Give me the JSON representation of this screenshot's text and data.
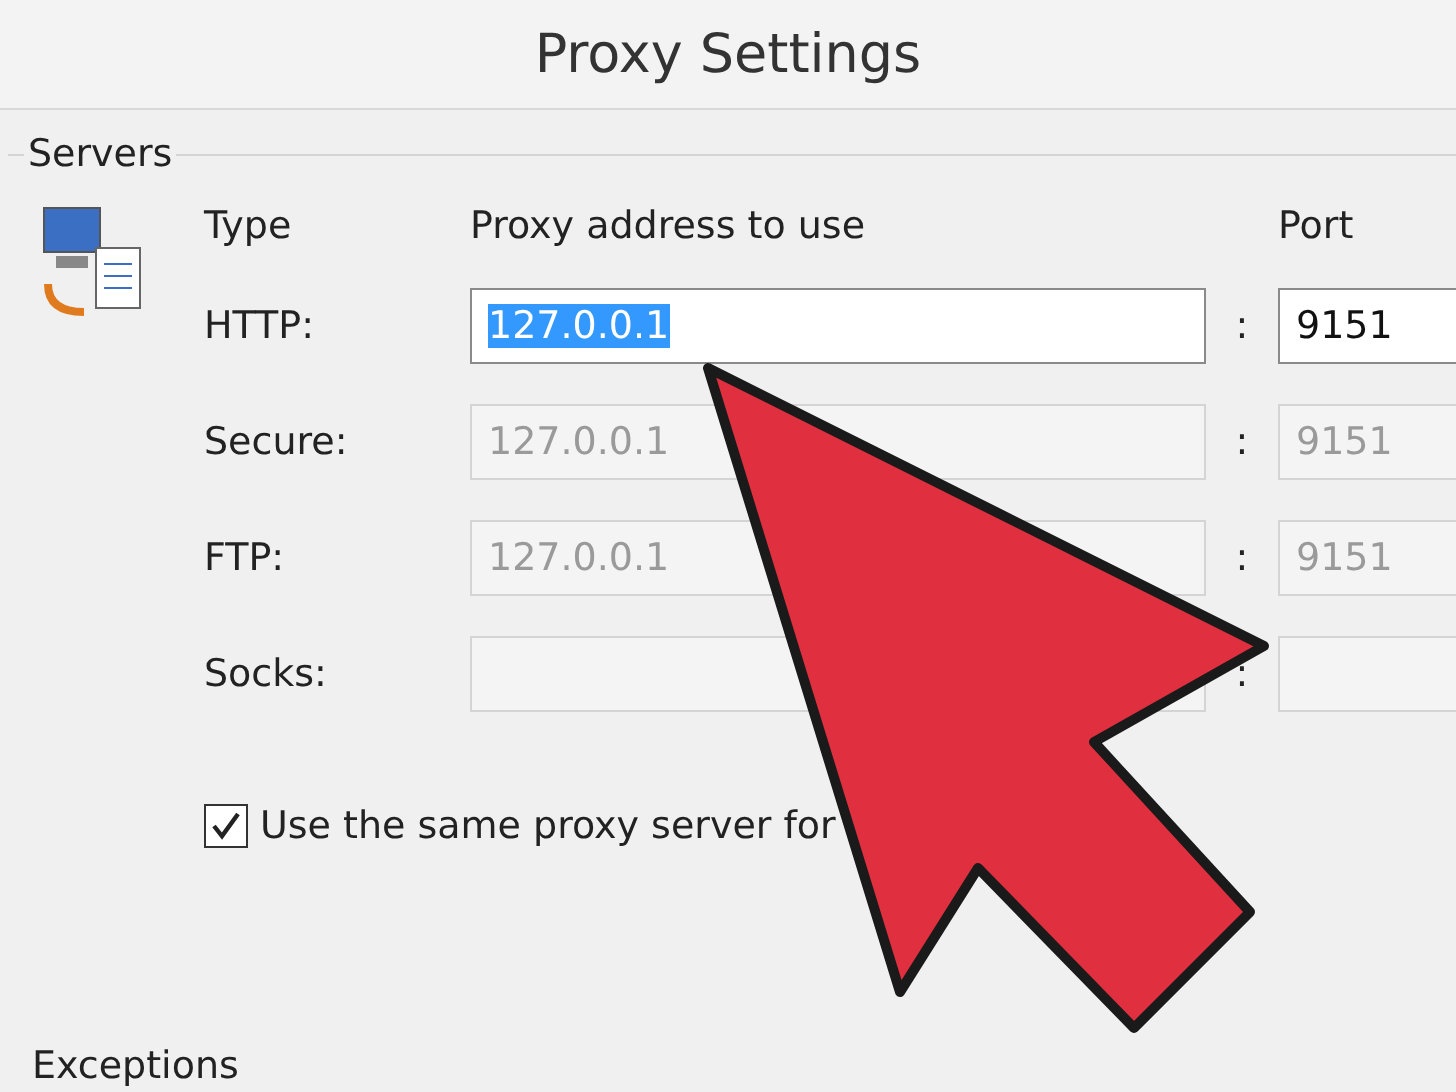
{
  "window": {
    "title": "Proxy Settings"
  },
  "servers": {
    "title": "Servers",
    "columns": [
      "Type",
      "Proxy address to use",
      "Port"
    ],
    "rows": [
      {
        "label": "HTTP:",
        "address": "127.0.0.1",
        "port": "9151",
        "disabled": false,
        "address_selected": true
      },
      {
        "label": "Secure:",
        "address": "127.0.0.1",
        "port": "9151",
        "disabled": true
      },
      {
        "label": "FTP:",
        "address": "127.0.0.1",
        "port": "9151",
        "disabled": true
      },
      {
        "label": "Socks:",
        "disabled": true
      }
    ],
    "separator": ":",
    "same_proxy": {
      "label": "Use the same proxy server for",
      "checked": true
    }
  },
  "exceptions": {
    "title": "Exceptions"
  }
}
